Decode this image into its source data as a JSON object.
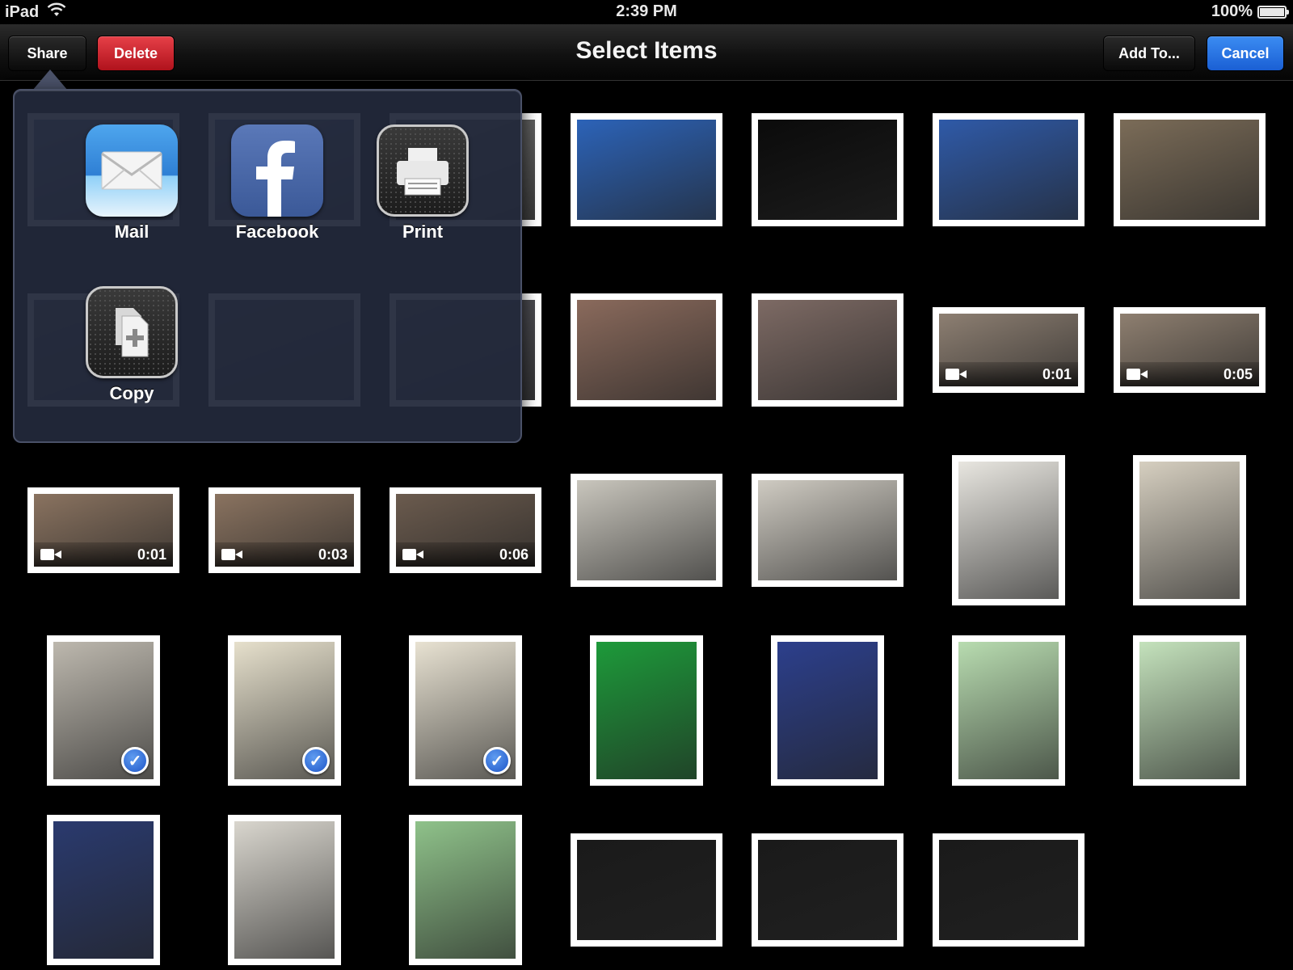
{
  "status_bar": {
    "device": "iPad",
    "time": "2:39 PM",
    "battery": "100%"
  },
  "toolbar": {
    "title": "Select Items",
    "share_label": "Share",
    "delete_label": "Delete",
    "add_to_label": "Add To...",
    "cancel_label": "Cancel"
  },
  "share_menu": {
    "items": [
      {
        "label": "Mail",
        "icon": "mail-icon"
      },
      {
        "label": "Facebook",
        "icon": "facebook-icon"
      },
      {
        "label": "Print",
        "icon": "print-icon"
      },
      {
        "label": "Copy",
        "icon": "copy-icon"
      }
    ]
  },
  "photos": {
    "rows": [
      {
        "items": [
          {
            "kind": "photo",
            "color": "#6b7da0"
          },
          {
            "kind": "photo",
            "color": "#5d6f8e"
          },
          {
            "kind": "photo",
            "color": "#707070"
          },
          {
            "kind": "photo",
            "color": "#2c63b8"
          },
          {
            "kind": "photo",
            "color": "#0b0b0b"
          },
          {
            "kind": "photo",
            "color": "#2f5aa8"
          },
          {
            "kind": "photo",
            "color": "#7b6c58"
          }
        ]
      },
      {
        "items": [
          {
            "kind": "photo",
            "color": "#5a5a62"
          },
          {
            "kind": "photo",
            "color": "#4e4e56"
          },
          {
            "kind": "photo",
            "color": "#55555c"
          },
          {
            "kind": "photo",
            "color": "#8a6a5c"
          },
          {
            "kind": "photo",
            "color": "#7d6a64"
          },
          {
            "kind": "video",
            "color": "#8d7f72",
            "duration": "0:01"
          },
          {
            "kind": "video",
            "color": "#8e7f70",
            "duration": "0:05"
          }
        ]
      },
      {
        "items": [
          {
            "kind": "video",
            "color": "#8a7360",
            "duration": "0:01"
          },
          {
            "kind": "video",
            "color": "#8a7360",
            "duration": "0:03"
          },
          {
            "kind": "video",
            "color": "#6b5b4e",
            "duration": "0:06"
          },
          {
            "kind": "photo",
            "color": "#c9c6bd"
          },
          {
            "kind": "photo",
            "color": "#cfcbc2"
          },
          {
            "kind": "photo",
            "color": "#e8e6e0"
          },
          {
            "kind": "photo",
            "color": "#d6cfc0"
          }
        ]
      },
      {
        "items": [
          {
            "kind": "photo",
            "color": "#bdb8ae",
            "selected": true
          },
          {
            "kind": "photo",
            "color": "#e6e0cc",
            "selected": true
          },
          {
            "kind": "photo",
            "color": "#e8e2d2",
            "selected": true
          },
          {
            "kind": "photo",
            "color": "#1d9a3a"
          },
          {
            "kind": "photo",
            "color": "#2c3f8c"
          },
          {
            "kind": "photo",
            "color": "#b8dcb0"
          },
          {
            "kind": "photo",
            "color": "#c4e2bc"
          }
        ]
      },
      {
        "items": [
          {
            "kind": "photo",
            "color": "#2a3a6e"
          },
          {
            "kind": "photo",
            "color": "#d9d6ce"
          },
          {
            "kind": "photo",
            "color": "#8fc28a"
          },
          {
            "kind": "photo",
            "color": "#1a1a1a"
          },
          {
            "kind": "photo",
            "color": "#1a1a1a"
          },
          {
            "kind": "photo",
            "color": "#1a1a1a"
          }
        ]
      }
    ]
  },
  "colors": {
    "delete": "#c41a24",
    "cancel": "#2a74e0",
    "selected_check": "#2a66d6"
  }
}
